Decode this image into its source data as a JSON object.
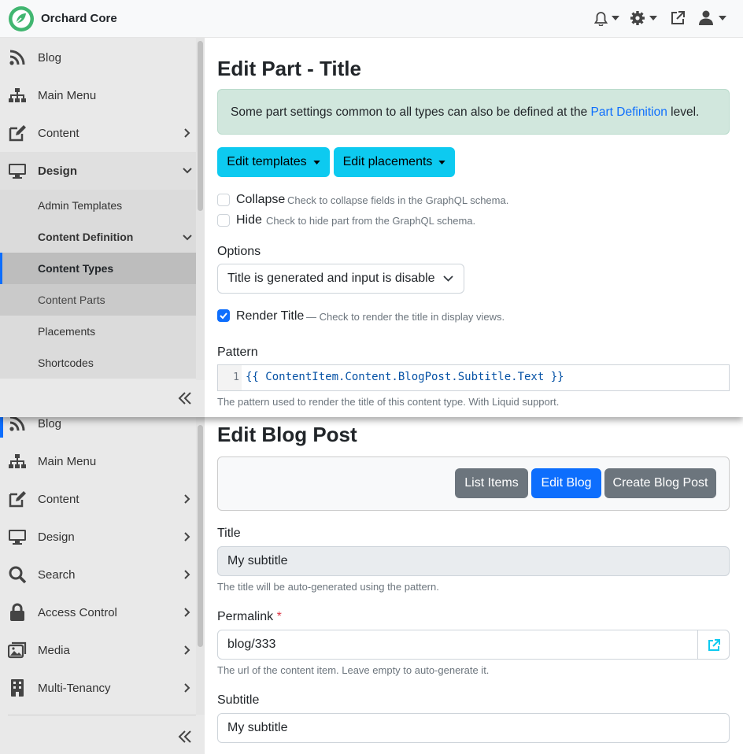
{
  "topbar": {
    "brand": "Orchard Core"
  },
  "front": {
    "sidebar": {
      "items": [
        {
          "label": "Blog",
          "icon": "rss-icon"
        },
        {
          "label": "Main Menu",
          "icon": "sitemap-icon"
        },
        {
          "label": "Content",
          "icon": "edit-icon"
        },
        {
          "label": "Design",
          "icon": "monitor-icon"
        }
      ],
      "design_children": [
        "Admin Templates",
        "Content Definition",
        "Content Types",
        "Content Parts",
        "Placements",
        "Shortcodes"
      ]
    },
    "title": "Edit Part - Title",
    "alert": {
      "text_before": "Some part settings common to all types can also be defined at the ",
      "link": "Part Definition",
      "text_after": " level."
    },
    "edit_templates_label": "Edit templates",
    "edit_placements_label": "Edit placements",
    "collapse": {
      "label": "Collapse",
      "help": "Check to collapse fields in the GraphQL schema."
    },
    "hide": {
      "label": "Hide",
      "help": "Check to hide part from the GraphQL schema."
    },
    "options_label": "Options",
    "options_value": "Title is generated and input is disable",
    "render_title": {
      "label": "Render Title",
      "help": "— Check to render the title in display views."
    },
    "pattern_label": "Pattern",
    "pattern_line_no": "1",
    "pattern_code": "{{ ContentItem.Content.BlogPost.Subtitle.Text }}",
    "pattern_help": "The pattern used to render the title of this content type. With Liquid support."
  },
  "back": {
    "sidebar": {
      "items": [
        {
          "label": "Blog"
        },
        {
          "label": "Main Menu"
        },
        {
          "label": "Content"
        },
        {
          "label": "Design"
        },
        {
          "label": "Search"
        },
        {
          "label": "Access Control"
        },
        {
          "label": "Media"
        },
        {
          "label": "Multi-Tenancy"
        }
      ]
    },
    "title": "Edit Blog Post",
    "buttons": {
      "list_items": "List Items",
      "edit_blog": "Edit Blog",
      "create_blog_post": "Create Blog Post"
    },
    "title_field": {
      "label": "Title",
      "value": "My subtitle",
      "help": "The title will be auto-generated using the pattern."
    },
    "permalink": {
      "label": "Permalink",
      "required": "*",
      "value": "blog/333",
      "help": "The url of the content item. Leave empty to auto-generate it."
    },
    "subtitle": {
      "label": "Subtitle",
      "value": "My subtitle"
    }
  },
  "colors": {
    "brand_green": "#41b670",
    "info_cyan": "#0dcaf0",
    "primary_blue": "#0d6efd",
    "secondary_gray": "#6c757d",
    "alert_bg": "#d1e7dd"
  }
}
